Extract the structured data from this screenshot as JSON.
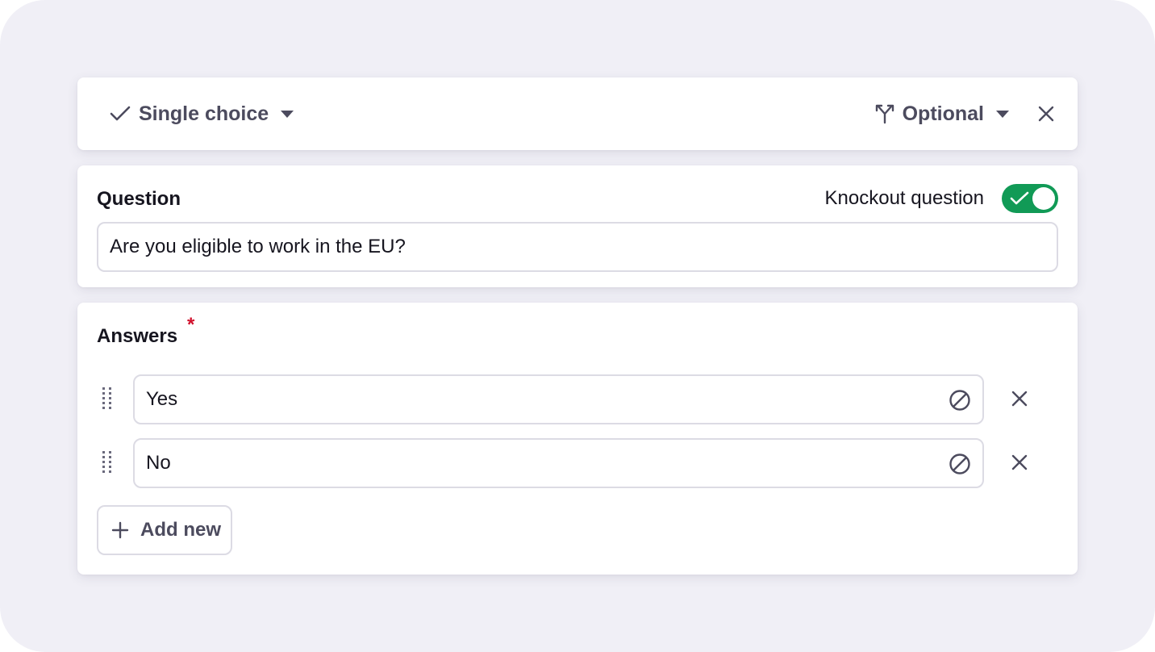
{
  "toolbar": {
    "type_label": "Single choice",
    "type_icon": "checkmark-icon",
    "requirement_label": "Optional",
    "requirement_icon": "branch-icon"
  },
  "question": {
    "label": "Question",
    "knockout_label": "Knockout question",
    "knockout_enabled": true,
    "value": "Are you eligible to work in the EU?"
  },
  "answers": {
    "label": "Answers",
    "required_marker": "*",
    "items": [
      {
        "value": "Yes"
      },
      {
        "value": "No"
      }
    ],
    "add_label": "Add new"
  },
  "colors": {
    "background": "#f0eff6",
    "toggle_on": "#119a56",
    "required": "#d1122d",
    "text_muted": "#4c4b5e"
  }
}
